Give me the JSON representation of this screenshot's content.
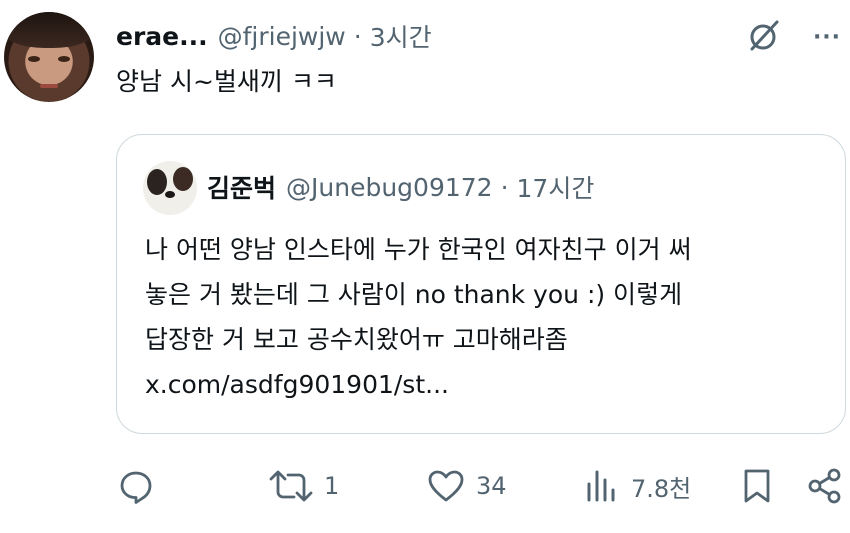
{
  "tweet": {
    "display_name": "erae...",
    "handle": "@fjriejwjw",
    "separator": "·",
    "time": "3시간",
    "text": "양남 시~벌새끼 ㅋㅋ",
    "more_label": "···"
  },
  "quoted": {
    "display_name": "김준벅",
    "handle": "@Junebug09172",
    "separator": "·",
    "time": "17시간",
    "lines": [
      "나 어떤 양남 인스타에 누가 한국인 여자친구 이거 써",
      "놓은 거 봤는데 그 사람이 no thank you :) 이렇게",
      "답장한 거 보고 공수치왔어ㅠ 고마해라좀",
      "x.com/asdfg901901/st..."
    ]
  },
  "actions": {
    "reply": {
      "icon": "reply-icon",
      "count": ""
    },
    "repost": {
      "icon": "repost-icon",
      "count": "1"
    },
    "like": {
      "icon": "heart-icon",
      "count": "34"
    },
    "views": {
      "icon": "views-icon",
      "count": "7.8천"
    },
    "bookmark": {
      "icon": "bookmark-icon",
      "count": ""
    },
    "share": {
      "icon": "share-icon",
      "count": ""
    }
  }
}
